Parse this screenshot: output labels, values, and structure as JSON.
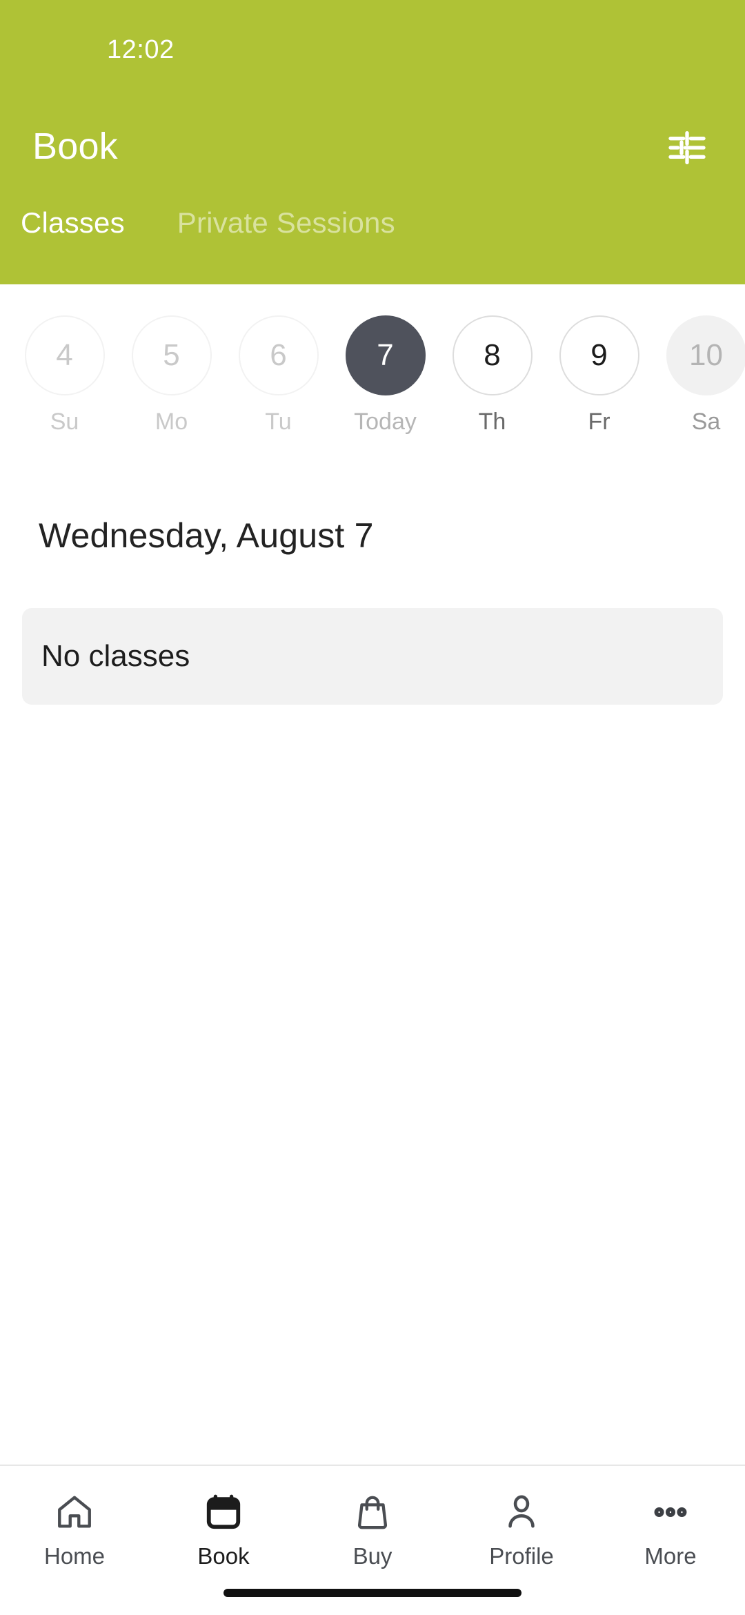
{
  "status_bar": {
    "time": "12:02"
  },
  "header": {
    "title": "Book",
    "filter_icon": "tune-icon",
    "background_color": "#AFC236",
    "tabs": [
      {
        "label": "Classes",
        "active": true
      },
      {
        "label": "Private Sessions",
        "active": false
      }
    ]
  },
  "date_strip": {
    "days": [
      {
        "date": "4",
        "label": "Su",
        "state": "past"
      },
      {
        "date": "5",
        "label": "Mo",
        "state": "past"
      },
      {
        "date": "6",
        "label": "Tu",
        "state": "past"
      },
      {
        "date": "7",
        "label": "Today",
        "state": "today"
      },
      {
        "date": "8",
        "label": "Th",
        "state": "future"
      },
      {
        "date": "9",
        "label": "Fr",
        "state": "future"
      },
      {
        "date": "10",
        "label": "Sa",
        "state": "muted"
      }
    ],
    "selected_color": "#4F525C"
  },
  "content": {
    "day_heading": "Wednesday, August 7",
    "empty_message": "No classes"
  },
  "bottom_nav": {
    "items": [
      {
        "label": "Home",
        "icon": "home-icon",
        "active": false
      },
      {
        "label": "Book",
        "icon": "calendar-icon",
        "active": true
      },
      {
        "label": "Buy",
        "icon": "shopping-bag-icon",
        "active": false
      },
      {
        "label": "Profile",
        "icon": "person-icon",
        "active": false
      },
      {
        "label": "More",
        "icon": "more-dots-icon",
        "active": false
      }
    ]
  }
}
